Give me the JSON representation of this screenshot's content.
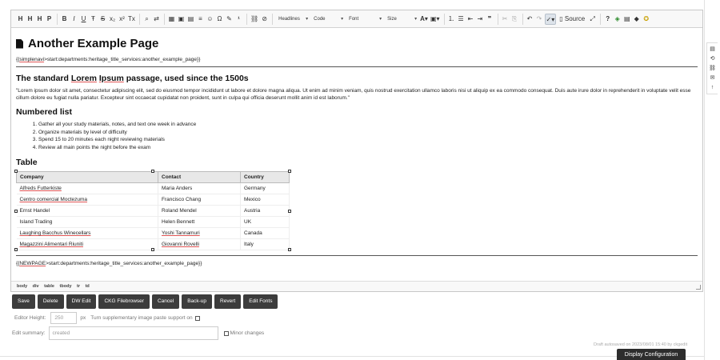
{
  "toolbar": {
    "headings": [
      "H",
      "H",
      "H",
      "P"
    ],
    "format": [
      "B",
      "I",
      "U",
      "Ŧ",
      "S",
      "x₂",
      "x²",
      "Tx"
    ],
    "insert": [
      "⌕",
      "◫",
      "Ω",
      "☺"
    ],
    "combos": {
      "headlines": "Headlines",
      "code": "Code",
      "font": "Font",
      "size": "Size"
    },
    "source_label": "Source"
  },
  "content": {
    "title": "Another Example Page",
    "simplenavi": {
      "pre": "{{",
      "word": "simplenavi",
      "post": ">start:departments:heritage_title_services:another_example_page}}"
    },
    "h2_lorem": {
      "pre": "The standard ",
      "w1": "Lorem",
      "sp": " ",
      "w2": "Ipsum",
      "post": " passage, used since the 1500s"
    },
    "lorem_text": "\"Lorem ipsum dolor sit amet, consectetur adipiscing elit, sed do eiusmod tempor incididunt ut labore et dolore magna aliqua. Ut enim ad minim veniam, quis nostrud exercitation ullamco laboris nisi ut aliquip ex ea commodo consequat. Duis aute irure dolor in reprehenderit in voluptate velit esse cillum dolore eu fugiat nulla pariatur. Excepteur sint occaecat cupidatat non proident, sunt in culpa qui officia deserunt mollit anim id est laborum.\"",
    "h2_list": "Numbered list",
    "list": [
      "Gather all your study materials, notes, and text one week in advance",
      "Organize materials by level of difficulty",
      "Spend 15 to 20 minutes each night reviewing materials",
      "Review all main points the night before the exam"
    ],
    "h2_table": "Table",
    "table": {
      "headers": [
        "Company",
        "Contact",
        "Country"
      ],
      "rows": [
        [
          "Alfreds Futterkiste",
          "Maria Anders",
          "Germany"
        ],
        [
          "Centro comercial Moctezuma",
          "Francisco Chang",
          "Mexico"
        ],
        [
          "Ernst Handel",
          "Roland Mendel",
          "Austria"
        ],
        [
          "Island Trading",
          "Helen Bennett",
          "UK"
        ],
        [
          "Laughing Bacchus Winecellars",
          "Yoshi Tannamuri",
          "Canada"
        ],
        [
          "Magazzini Alimentari Riuniti",
          "Giovanni Rovelli",
          "Italy"
        ]
      ]
    },
    "newpage": {
      "pre": "{{",
      "word": "NEWPAGE",
      "post": ">start:departments:heritage_title_services:another_example_page}}"
    }
  },
  "status_path": [
    "body",
    "div",
    "table",
    "tbody",
    "tr",
    "td"
  ],
  "buttons": [
    "Save",
    "Delete",
    "DW Edit",
    "CKG Filebrowser",
    "Cancel",
    "Back-up",
    "Revert",
    "Edit Fonts"
  ],
  "editor_height": {
    "label": "Editor Height:",
    "value": "250",
    "unit": "px",
    "paste_label": "Turn supplementary image paste support on"
  },
  "summary": {
    "label": "Edit summary:",
    "value": "created",
    "minor_label": "Minor changes"
  },
  "autosave": "Draft autosaved on 2023/08/01 15:40 by ckgedit",
  "display_config": "Display Configuration",
  "side_tools": [
    "▤",
    "⟲",
    "⛓",
    "✉",
    "↑"
  ]
}
